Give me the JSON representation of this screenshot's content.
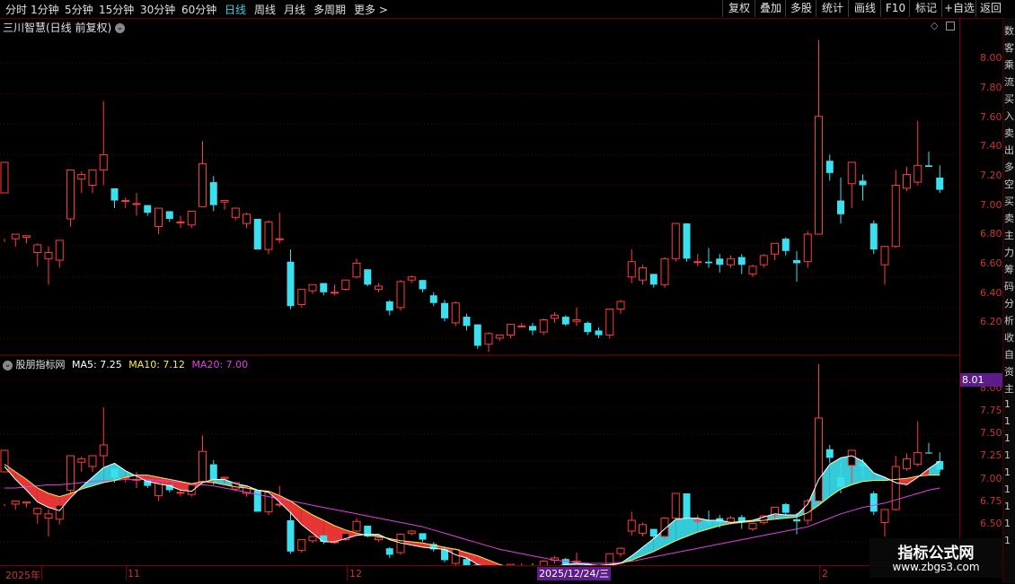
{
  "toolbar": {
    "periods": [
      "分时",
      "1分钟",
      "5分钟",
      "15分钟",
      "30分钟",
      "60分钟",
      "日线",
      "周线",
      "月线",
      "多周期",
      "更多 >"
    ],
    "active_period": "日线",
    "buttons": [
      "复权",
      "叠加",
      "多股",
      "统计",
      "画线",
      "F10",
      "标记",
      "+自选",
      "返回"
    ]
  },
  "main_panel": {
    "title": "三川智慧(日线 前复权)",
    "price_ticks": [
      "8.00",
      "7.80",
      "7.60",
      "7.40",
      "7.20",
      "7.00",
      "6.80",
      "6.60",
      "6.40",
      "6.20"
    ]
  },
  "indicator_panel": {
    "name": "股朋指标网",
    "ma5": "MA5: 7.25",
    "ma10": "MA10: 7.12",
    "ma20": "MA20: 7.00",
    "price_ticks": [
      "8.00",
      "7.75",
      "7.50",
      "7.25",
      "7.00",
      "6.75",
      "6.50"
    ],
    "cursor_price": "8.01"
  },
  "date_axis": {
    "labels": [
      "2025年",
      "11",
      "12",
      "2"
    ],
    "cursor_date": "2025/12/24/三"
  },
  "side_strip": {
    "chars": [
      "数",
      "客",
      "乘",
      "流",
      "买",
      "入",
      "卖",
      "出",
      "多",
      "空",
      "买",
      "卖",
      "主",
      "力",
      "筹",
      "码",
      "分",
      "析",
      "收",
      "自",
      "资",
      "主",
      "1",
      "1",
      "1",
      "1",
      "1",
      "1",
      "1",
      "1",
      "1"
    ]
  },
  "watermark": {
    "text": "指标公式网",
    "url": "www.zbgs3.com"
  },
  "colors": {
    "up": "#ff3b3b",
    "down": "#3ae0ee",
    "ma5": "#ffffff",
    "ma10": "#ffe84a",
    "ma20": "#e040e0",
    "axis": "#c33333",
    "grid": "#5a0000"
  },
  "chart_data": {
    "type": "candlestick",
    "price_range_main": [
      6.1,
      8.2
    ],
    "price_range_indicator": [
      6.3,
      8.1
    ],
    "candles": [
      [
        7.15,
        7.35,
        6.85,
        6.83,
        6.85
      ],
      [
        6.85,
        6.88,
        6.85,
        6.8,
        6.88
      ],
      [
        6.86,
        6.87,
        6.84,
        6.82,
        6.86
      ],
      [
        6.76,
        6.81,
        6.76,
        6.67,
        6.82
      ],
      [
        6.72,
        6.76,
        6.71,
        6.55,
        6.8
      ],
      [
        6.71,
        6.84,
        6.71,
        6.66,
        6.84
      ],
      [
        6.98,
        7.3,
        6.98,
        6.93,
        7.3
      ],
      [
        7.24,
        7.27,
        7.24,
        7.15,
        7.29
      ],
      [
        7.2,
        7.3,
        7.2,
        7.15,
        7.3
      ],
      [
        7.3,
        7.4,
        7.3,
        7.2,
        7.75
      ],
      [
        7.18,
        7.1,
        7.1,
        7.05,
        7.18
      ],
      [
        7.1,
        7.1,
        7.09,
        7.05,
        7.12
      ],
      [
        7.08,
        7.08,
        7.08,
        7.0,
        7.15
      ],
      [
        7.07,
        7.02,
        7.02,
        7.0,
        7.07
      ],
      [
        6.93,
        7.05,
        6.93,
        6.88,
        7.05
      ],
      [
        7.03,
        6.98,
        6.98,
        6.96,
        7.03
      ],
      [
        6.96,
        6.96,
        6.96,
        6.92,
        7.0
      ],
      [
        6.94,
        7.03,
        6.94,
        6.92,
        7.03
      ],
      [
        7.06,
        7.34,
        7.06,
        7.06,
        7.49
      ],
      [
        7.22,
        7.07,
        7.07,
        7.03,
        7.26
      ],
      [
        7.09,
        7.1,
        7.04,
        7.04,
        7.1
      ],
      [
        6.99,
        7.05,
        6.99,
        6.97,
        7.05
      ],
      [
        6.95,
        7.01,
        6.95,
        6.92,
        7.02
      ],
      [
        6.98,
        6.78,
        6.78,
        6.78,
        6.98
      ],
      [
        6.78,
        6.96,
        6.78,
        6.75,
        6.97
      ],
      [
        6.85,
        6.85,
        6.84,
        6.82,
        7.02
      ],
      [
        6.7,
        6.41,
        6.41,
        6.39,
        6.78
      ],
      [
        6.42,
        6.52,
        6.42,
        6.4,
        6.52
      ],
      [
        6.51,
        6.55,
        6.51,
        6.49,
        6.55
      ],
      [
        6.56,
        6.5,
        6.5,
        6.48,
        6.56
      ],
      [
        6.5,
        6.5,
        6.5,
        6.48,
        6.55
      ],
      [
        6.52,
        6.58,
        6.52,
        6.51,
        6.58
      ],
      [
        6.6,
        6.69,
        6.6,
        6.59,
        6.72
      ],
      [
        6.65,
        6.55,
        6.55,
        6.54,
        6.65
      ],
      [
        6.52,
        6.54,
        6.52,
        6.5,
        6.56
      ],
      [
        6.44,
        6.38,
        6.38,
        6.35,
        6.45
      ],
      [
        6.4,
        6.57,
        6.4,
        6.38,
        6.58
      ],
      [
        6.58,
        6.6,
        6.58,
        6.56,
        6.61
      ],
      [
        6.58,
        6.52,
        6.52,
        6.5,
        6.58
      ],
      [
        6.48,
        6.43,
        6.43,
        6.41,
        6.5
      ],
      [
        6.43,
        6.33,
        6.33,
        6.31,
        6.45
      ],
      [
        6.3,
        6.43,
        6.3,
        6.28,
        6.44
      ],
      [
        6.34,
        6.28,
        6.28,
        6.25,
        6.36
      ],
      [
        6.29,
        6.15,
        6.15,
        6.13,
        6.29
      ],
      [
        6.16,
        6.23,
        6.16,
        6.11,
        6.24
      ],
      [
        6.2,
        6.22,
        6.2,
        6.18,
        6.22
      ],
      [
        6.22,
        6.29,
        6.22,
        6.2,
        6.29
      ],
      [
        6.28,
        6.28,
        6.27,
        6.27,
        6.3
      ],
      [
        6.28,
        6.25,
        6.25,
        6.22,
        6.3
      ],
      [
        6.24,
        6.32,
        6.24,
        6.22,
        6.33
      ],
      [
        6.33,
        6.35,
        6.33,
        6.3,
        6.37
      ],
      [
        6.34,
        6.29,
        6.29,
        6.28,
        6.35
      ],
      [
        6.31,
        6.32,
        6.31,
        6.28,
        6.4
      ],
      [
        6.3,
        6.24,
        6.24,
        6.22,
        6.31
      ],
      [
        6.25,
        6.22,
        6.22,
        6.2,
        6.27
      ],
      [
        6.22,
        6.39,
        6.22,
        6.2,
        6.39
      ],
      [
        6.39,
        6.44,
        6.39,
        6.36,
        6.45
      ],
      [
        6.6,
        6.7,
        6.6,
        6.56,
        6.78
      ],
      [
        6.58,
        6.66,
        6.58,
        6.55,
        6.68
      ],
      [
        6.62,
        6.55,
        6.55,
        6.53,
        6.62
      ],
      [
        6.55,
        6.72,
        6.55,
        6.53,
        6.73
      ],
      [
        6.72,
        6.95,
        6.72,
        6.7,
        6.95
      ],
      [
        6.95,
        6.72,
        6.72,
        6.7,
        6.95
      ],
      [
        6.7,
        6.7,
        6.7,
        6.67,
        6.75
      ],
      [
        6.7,
        6.69,
        6.69,
        6.66,
        6.79
      ],
      [
        6.72,
        6.68,
        6.68,
        6.63,
        6.75
      ],
      [
        6.68,
        6.72,
        6.68,
        6.66,
        6.74
      ],
      [
        6.73,
        6.68,
        6.68,
        6.62,
        6.75
      ],
      [
        6.62,
        6.67,
        6.62,
        6.6,
        6.68
      ],
      [
        6.68,
        6.74,
        6.68,
        6.66,
        6.75
      ],
      [
        6.75,
        6.82,
        6.75,
        6.71,
        6.82
      ],
      [
        6.85,
        6.77,
        6.77,
        6.74,
        6.86
      ],
      [
        6.71,
        6.69,
        6.69,
        6.57,
        6.77
      ],
      [
        6.7,
        6.88,
        6.7,
        6.66,
        6.9
      ],
      [
        6.88,
        7.65,
        6.88,
        6.88,
        8.15
      ],
      [
        7.36,
        7.28,
        7.28,
        7.23,
        7.4
      ],
      [
        7.1,
        7.01,
        7.01,
        6.95,
        7.25
      ],
      [
        7.21,
        7.35,
        7.21,
        7.05,
        7.35
      ],
      [
        7.23,
        7.2,
        7.19,
        7.1,
        7.27
      ],
      [
        6.95,
        6.78,
        6.78,
        6.75,
        6.97
      ],
      [
        6.68,
        6.8,
        6.68,
        6.55,
        6.8
      ],
      [
        6.8,
        7.2,
        6.8,
        6.79,
        7.3
      ],
      [
        7.18,
        7.27,
        7.18,
        7.16,
        7.32
      ],
      [
        7.22,
        7.33,
        7.22,
        7.2,
        7.62
      ],
      [
        7.33,
        7.32,
        7.32,
        7.32,
        7.42
      ],
      [
        7.25,
        7.17,
        7.17,
        7.15,
        7.33
      ]
    ],
    "ma_series": [
      {
        "name": "MA5",
        "values": [
          7.2,
          7.08,
          6.98,
          6.87,
          6.82,
          6.79,
          6.91,
          7.01,
          7.1,
          7.19,
          7.23,
          7.16,
          7.11,
          7.06,
          7.04,
          7.02,
          6.98,
          6.97,
          7.05,
          7.08,
          7.08,
          7.04,
          7.02,
          6.98,
          6.96,
          6.87,
          6.77,
          6.66,
          6.58,
          6.5,
          6.5,
          6.53,
          6.56,
          6.57,
          6.57,
          6.52,
          6.49,
          6.47,
          6.45,
          6.44,
          6.43,
          6.38,
          6.35,
          6.29,
          6.23,
          6.2,
          6.21,
          6.21,
          6.22,
          6.24,
          6.27,
          6.29,
          6.3,
          6.29,
          6.28,
          6.29,
          6.3,
          6.37,
          6.45,
          6.53,
          6.62,
          6.71,
          6.72,
          6.72,
          6.7,
          6.7,
          6.68,
          6.69,
          6.7,
          6.73,
          6.76,
          6.75,
          6.75,
          6.85,
          7.08,
          7.22,
          7.28,
          7.3,
          7.25,
          7.14,
          7.1,
          7.05,
          7.03,
          7.1,
          7.18,
          7.25
        ]
      },
      {
        "name": "MA10",
        "values": [
          7.22,
          7.15,
          7.08,
          7.0,
          6.95,
          6.92,
          6.95,
          6.99,
          7.02,
          7.05,
          7.07,
          7.1,
          7.12,
          7.12,
          7.1,
          7.08,
          7.06,
          7.04,
          7.06,
          7.05,
          7.03,
          7.01,
          7.0,
          6.98,
          6.97,
          6.93,
          6.88,
          6.81,
          6.75,
          6.7,
          6.65,
          6.61,
          6.58,
          6.56,
          6.55,
          6.53,
          6.51,
          6.5,
          6.49,
          6.47,
          6.45,
          6.43,
          6.4,
          6.37,
          6.33,
          6.29,
          6.26,
          6.24,
          6.23,
          6.22,
          6.23,
          6.24,
          6.25,
          6.26,
          6.26,
          6.28,
          6.3,
          6.33,
          6.37,
          6.41,
          6.46,
          6.51,
          6.55,
          6.59,
          6.62,
          6.65,
          6.67,
          6.68,
          6.69,
          6.7,
          6.71,
          6.72,
          6.73,
          6.77,
          6.84,
          6.92,
          6.99,
          7.03,
          7.06,
          7.07,
          7.07,
          7.08,
          7.09,
          7.11,
          7.12,
          7.12
        ]
      },
      {
        "name": "MA20",
        "values": [
          7.0,
          7.0,
          7.01,
          7.02,
          7.03,
          7.03,
          7.04,
          7.05,
          7.06,
          7.07,
          7.07,
          7.08,
          7.08,
          7.08,
          7.07,
          7.06,
          7.05,
          7.04,
          7.03,
          7.02,
          7.0,
          6.98,
          6.96,
          6.94,
          6.92,
          6.9,
          6.88,
          6.86,
          6.84,
          6.82,
          6.8,
          6.78,
          6.76,
          6.74,
          6.72,
          6.7,
          6.68,
          6.66,
          6.64,
          6.61,
          6.58,
          6.55,
          6.52,
          6.49,
          6.46,
          6.43,
          6.41,
          6.39,
          6.37,
          6.35,
          6.33,
          6.32,
          6.31,
          6.3,
          6.3,
          6.3,
          6.31,
          6.32,
          6.34,
          6.36,
          6.38,
          6.4,
          6.42,
          6.44,
          6.46,
          6.48,
          6.5,
          6.52,
          6.54,
          6.56,
          6.58,
          6.6,
          6.62,
          6.64,
          6.68,
          6.72,
          6.76,
          6.79,
          6.82,
          6.84,
          6.86,
          6.89,
          6.92,
          6.95,
          6.98,
          7.0
        ]
      }
    ]
  }
}
